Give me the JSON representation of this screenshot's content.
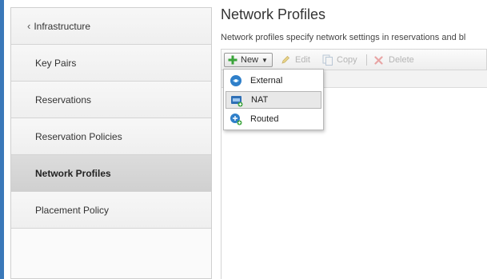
{
  "colors": {
    "accent": "#3a78b9",
    "active_row": "#d4d4d4"
  },
  "sidebar": {
    "back": {
      "label": "Infrastructure",
      "icon": "chevron-left-icon"
    },
    "items": [
      {
        "label": "Key Pairs"
      },
      {
        "label": "Reservations"
      },
      {
        "label": "Reservation Policies"
      },
      {
        "label": "Network Profiles",
        "active": true
      },
      {
        "label": "Placement Policy"
      }
    ]
  },
  "main": {
    "title": "Network Profiles",
    "description": "Network profiles specify network settings in reservations and bl"
  },
  "toolbar": {
    "new_label": "New",
    "edit_label": "Edit",
    "copy_label": "Copy",
    "delete_label": "Delete"
  },
  "dropdown": {
    "items": [
      {
        "label": "External",
        "icon": "external-network-icon"
      },
      {
        "label": "NAT",
        "icon": "nat-network-icon"
      },
      {
        "label": "Routed",
        "icon": "routed-network-icon"
      }
    ]
  }
}
